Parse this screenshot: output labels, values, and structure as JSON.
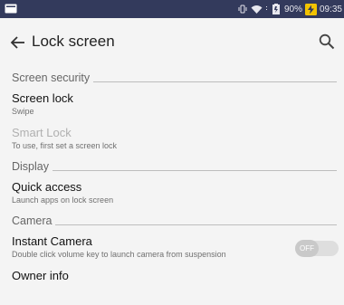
{
  "status_bar": {
    "battery": "90%",
    "time": "09:35",
    "icons": [
      "notification-icon",
      "vibrate-icon",
      "wifi-icon",
      "signal-icon",
      "battery-icon",
      "charging-icon"
    ]
  },
  "app_bar": {
    "title": "Lock screen",
    "back_icon": "arrow-left-icon",
    "search_icon": "search-icon"
  },
  "sections": {
    "screen_security": {
      "header": "Screen security",
      "items": [
        {
          "title": "Screen lock",
          "subtitle": "Swipe",
          "enabled": true
        },
        {
          "title": "Smart Lock",
          "subtitle": "To use, first set a screen lock",
          "enabled": false
        }
      ]
    },
    "display": {
      "header": "Display",
      "items": [
        {
          "title": "Quick access",
          "subtitle": "Launch apps on lock screen",
          "enabled": true
        }
      ]
    },
    "camera": {
      "header": "Camera",
      "items": [
        {
          "title": "Instant Camera",
          "subtitle": "Double click volume key to launch camera from suspension",
          "toggle_label": "OFF",
          "toggle_on": false
        }
      ]
    },
    "more": {
      "items": [
        {
          "title": "Owner info"
        }
      ]
    }
  },
  "colors": {
    "status_bar": "#333a5c",
    "background": "#f4f4f4",
    "disabled_text": "#b0b0b0"
  }
}
